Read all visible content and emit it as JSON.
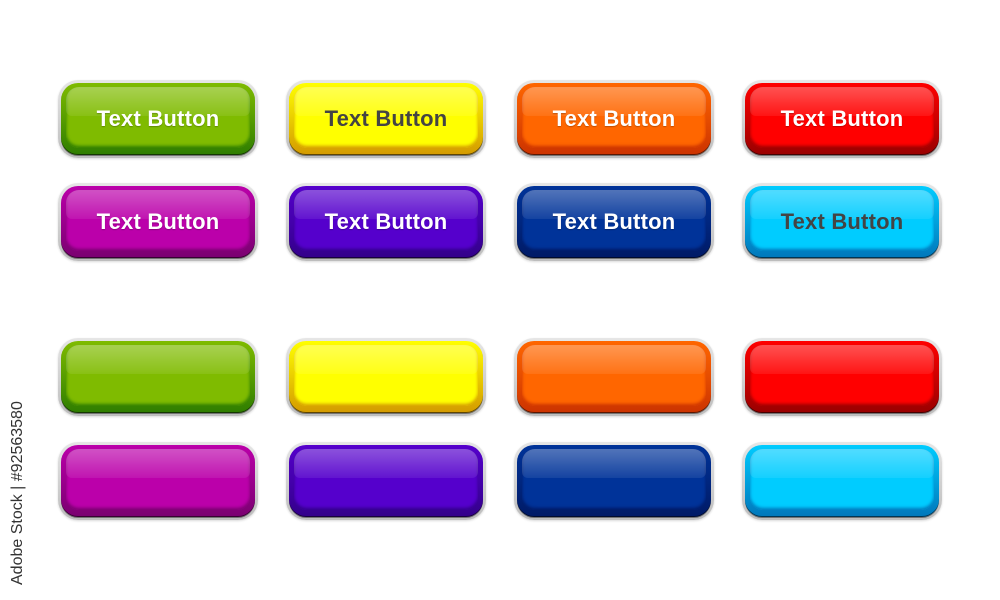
{
  "watermark": "Adobe Stock | #92563580",
  "labeled_buttons": [
    {
      "label": "Text Button",
      "color": "green",
      "face": "#7fbb00",
      "rim": "#2e7d00",
      "text_color": "#ffffff"
    },
    {
      "label": "Text Button",
      "color": "yellow",
      "face": "#ffff00",
      "rim": "#d49a00",
      "text_color": "#444444"
    },
    {
      "label": "Text Button",
      "color": "orange",
      "face": "#ff6600",
      "rim": "#cc3300",
      "text_color": "#ffffff"
    },
    {
      "label": "Text Button",
      "color": "red",
      "face": "#ff0000",
      "rim": "#990000",
      "text_color": "#ffffff"
    },
    {
      "label": "Text Button",
      "color": "magenta",
      "face": "#bb00aa",
      "rim": "#7a0070",
      "text_color": "#ffffff"
    },
    {
      "label": "Text Button",
      "color": "purple",
      "face": "#5500cc",
      "rim": "#33008a",
      "text_color": "#ffffff"
    },
    {
      "label": "Text Button",
      "color": "navy",
      "face": "#003399",
      "rim": "#001a66",
      "text_color": "#ffffff"
    },
    {
      "label": "Text Button",
      "color": "cyan",
      "face": "#00ccff",
      "rim": "#0077bb",
      "text_color": "#444444"
    }
  ],
  "blank_buttons": [
    {
      "color": "green",
      "face": "#7fbb00",
      "rim": "#2e7d00"
    },
    {
      "color": "yellow",
      "face": "#ffff00",
      "rim": "#d49a00"
    },
    {
      "color": "orange",
      "face": "#ff6600",
      "rim": "#cc3300"
    },
    {
      "color": "red",
      "face": "#ff0000",
      "rim": "#990000"
    },
    {
      "color": "magenta",
      "face": "#bb00aa",
      "rim": "#7a0070"
    },
    {
      "color": "purple",
      "face": "#5500cc",
      "rim": "#33008a"
    },
    {
      "color": "navy",
      "face": "#003399",
      "rim": "#001a66"
    },
    {
      "color": "cyan",
      "face": "#00ccff",
      "rim": "#0077bb"
    }
  ]
}
